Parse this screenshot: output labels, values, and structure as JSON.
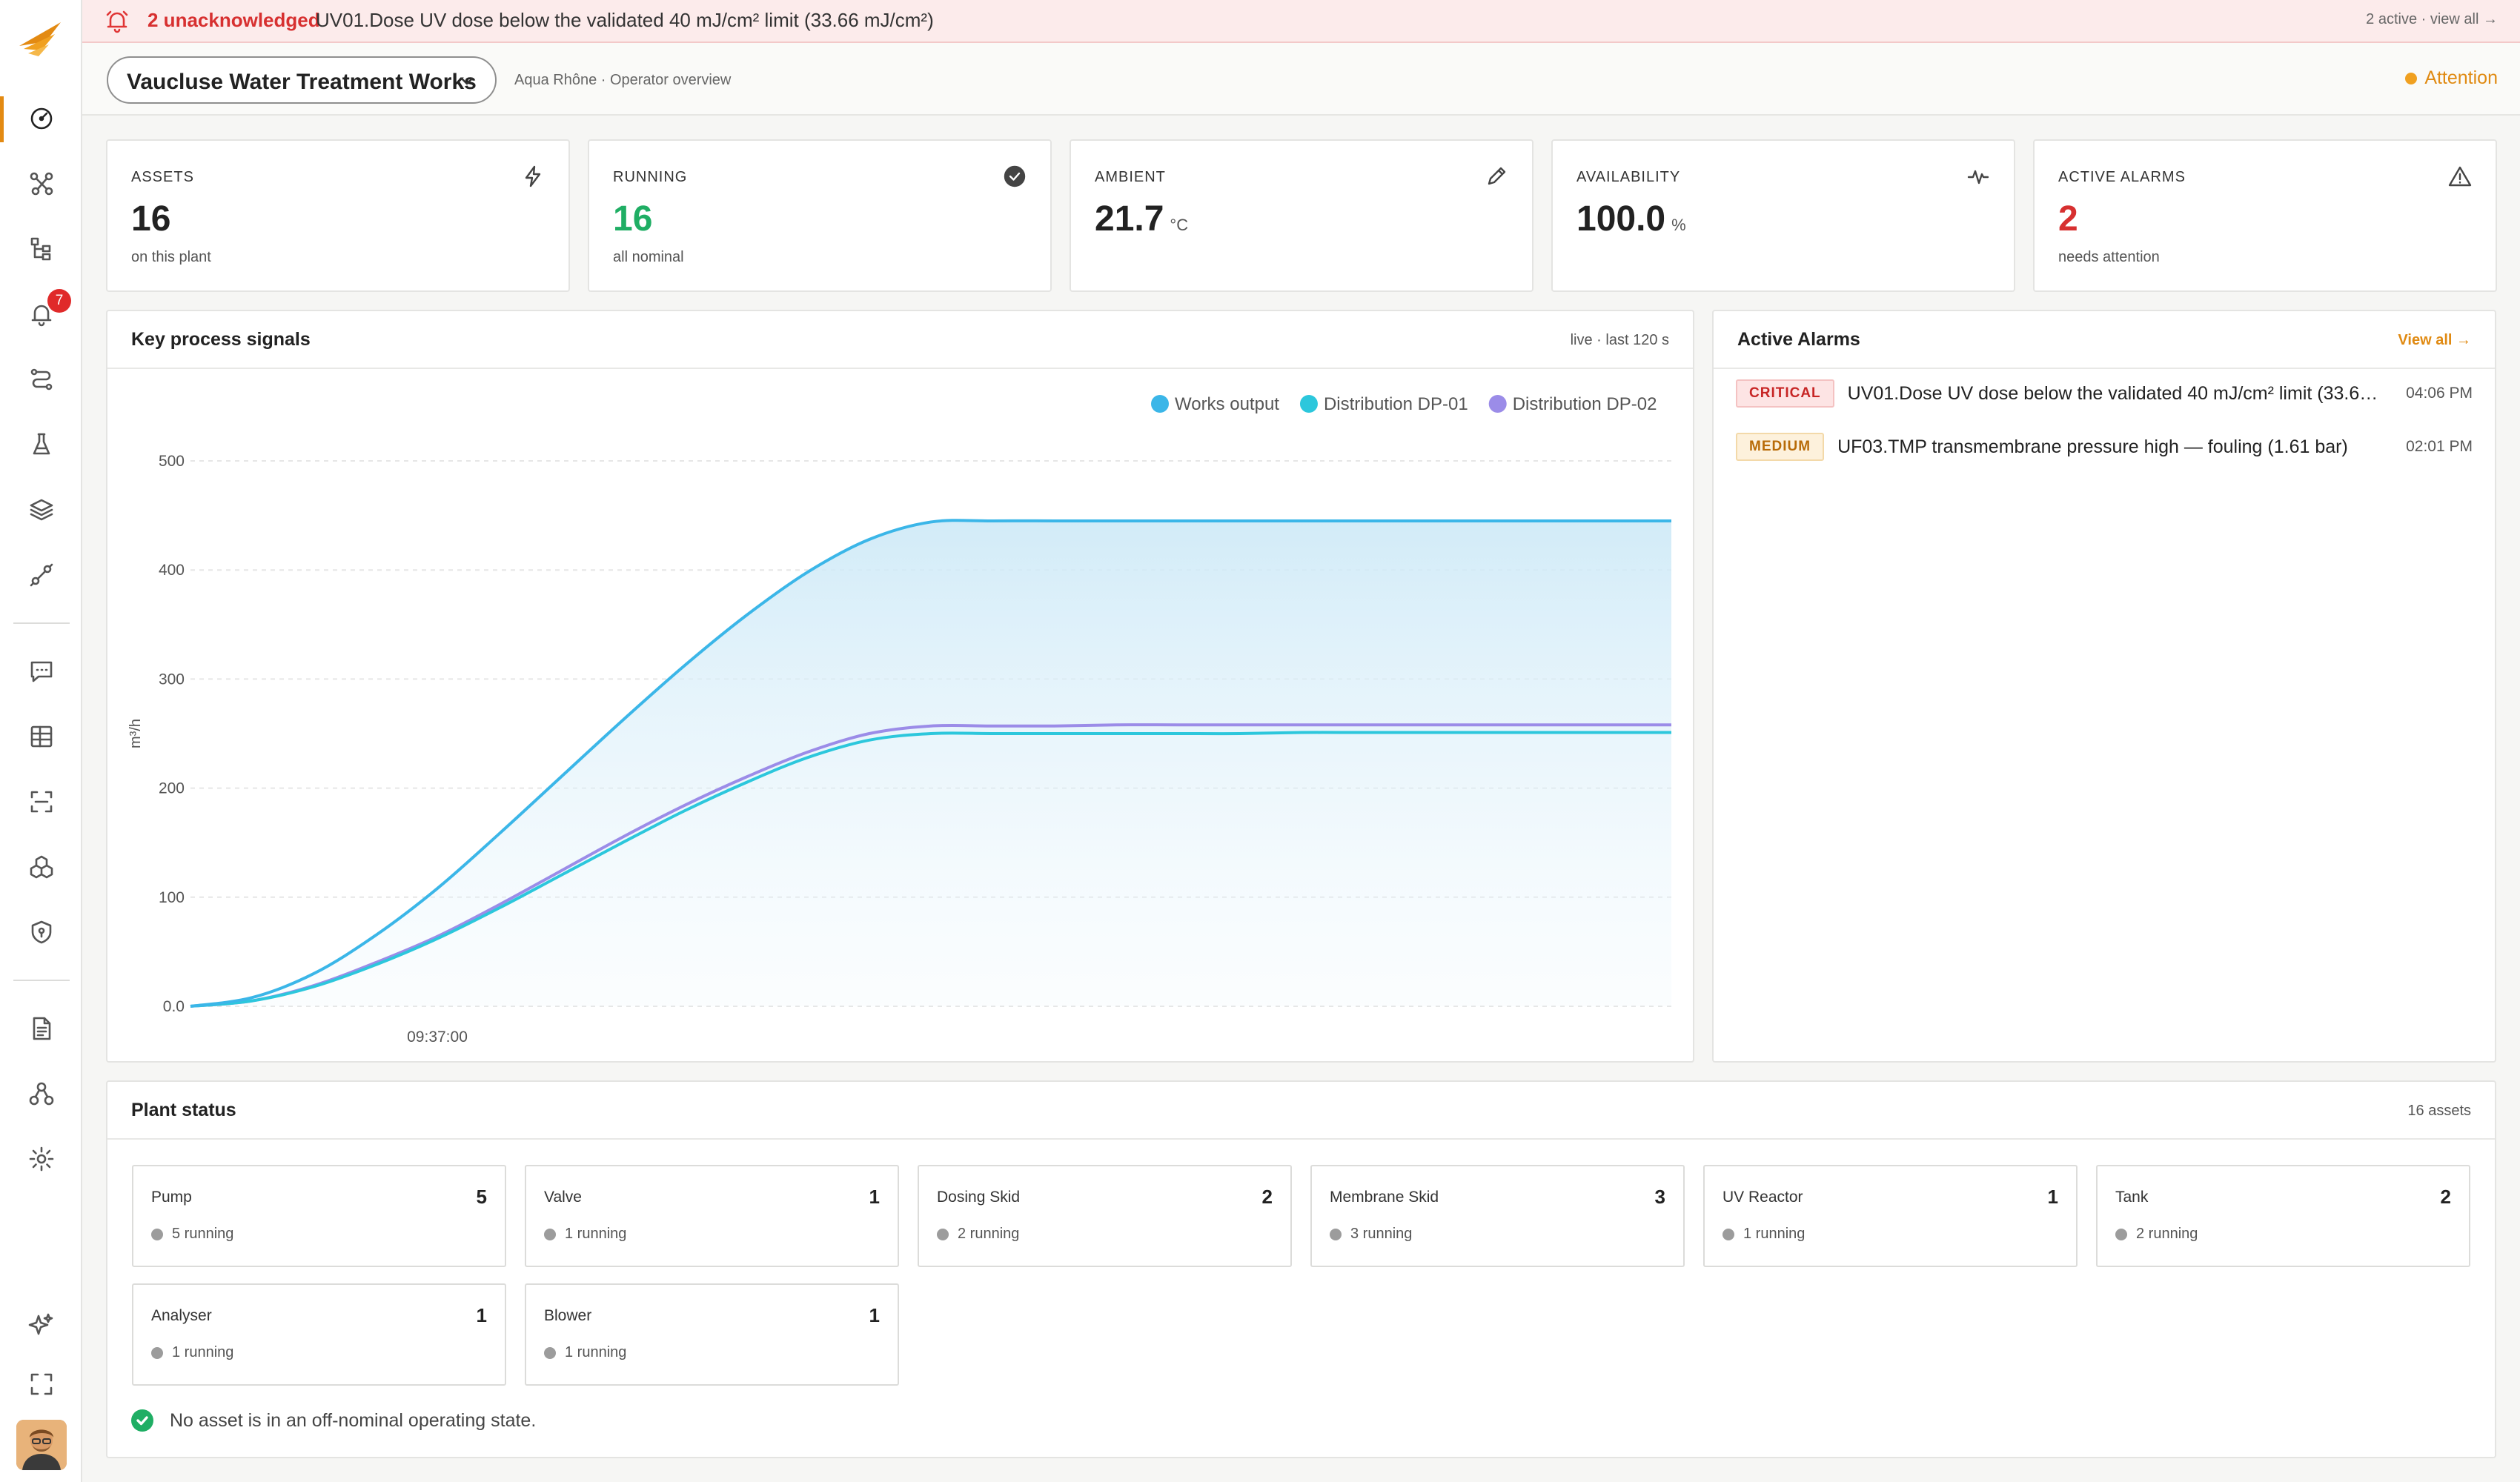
{
  "alert_banner": {
    "count_label": "2 unacknowledged",
    "message": "UV01.Dose UV dose below the validated 40 mJ/cm² limit (33.66 mJ/cm²)",
    "right_link": "2 active · view all →"
  },
  "sidebar": {
    "notification_badge": "7",
    "items": [
      "dashboard-icon",
      "connections-icon",
      "hierarchy-icon",
      "alarms-icon",
      "routes-icon",
      "lab-icon",
      "layers-icon",
      "integrations-icon",
      "messages-icon",
      "tables-icon",
      "scan-icon",
      "assets-icon",
      "security-icon",
      "reports-icon",
      "org-icon",
      "settings-icon",
      "sparkle-icon",
      "fullscreen-icon"
    ]
  },
  "header": {
    "plant_name": "Vaucluse Water Treatment Works",
    "subtitle": "Aqua Rhône · Operator overview",
    "status": "Attention",
    "status_color": "#f0a020"
  },
  "kpis": [
    {
      "label": "ASSETS",
      "value": "16",
      "unit": "",
      "sub": "on this plant",
      "icon": "bolt-icon"
    },
    {
      "label": "RUNNING",
      "value": "16",
      "unit": "",
      "sub": "all nominal",
      "icon": "check-circle-icon"
    },
    {
      "label": "AMBIENT",
      "value": "21.7",
      "unit": "°C",
      "sub": "",
      "icon": "pen-icon"
    },
    {
      "label": "AVAILABILITY",
      "value": "100.0",
      "unit": "%",
      "sub": "",
      "icon": "pulse-icon"
    },
    {
      "label": "ACTIVE ALARMS",
      "value": "2",
      "unit": "",
      "sub": "needs attention",
      "icon": "warning-icon"
    }
  ],
  "signals_panel": {
    "title": "Key process signals",
    "meta": "live · last 120 s"
  },
  "chart_data": {
    "type": "area",
    "title": "",
    "xlabel": "",
    "ylabel": "m³/h",
    "ylim": [
      0,
      500
    ],
    "y_ticks": [
      "0.0",
      "100",
      "200",
      "300",
      "400",
      "500"
    ],
    "x_tick_labels": [
      "09:37:00"
    ],
    "legend_position": "top-right",
    "grid": true,
    "x": [
      0,
      5,
      10,
      15,
      20,
      25,
      30,
      35,
      40,
      45,
      50,
      55,
      60,
      65,
      70,
      75,
      80,
      85,
      90,
      95,
      100,
      105,
      110,
      115,
      120
    ],
    "series": [
      {
        "name": "Works output",
        "color": "#3bb6e8",
        "values": [
          0,
          8,
          30,
          65,
          108,
          158,
          210,
          262,
          312,
          358,
          398,
          428,
          444,
          445,
          445,
          445,
          445,
          445,
          445,
          445,
          445,
          445,
          445,
          445,
          445
        ]
      },
      {
        "name": "Distribution DP-01",
        "color": "#2cc7dc",
        "values": [
          0,
          5,
          18,
          38,
          62,
          90,
          120,
          150,
          179,
          205,
          228,
          244,
          250,
          250,
          250,
          250,
          250,
          250,
          251,
          251,
          251,
          251,
          251,
          251,
          251
        ]
      },
      {
        "name": "Distribution DP-02",
        "color": "#9b8ce8",
        "values": [
          0,
          5,
          19,
          40,
          64,
          93,
          124,
          155,
          184,
          210,
          233,
          250,
          257,
          257,
          257,
          258,
          258,
          258,
          258,
          258,
          258,
          258,
          258,
          258,
          258
        ]
      }
    ]
  },
  "alarms_panel": {
    "title": "Active Alarms",
    "link": "View all →",
    "items": [
      {
        "severity": "CRITICAL",
        "text": "UV01.Dose UV dose below the validated 40 mJ/cm² limit (33.66 mJ/cm²)",
        "time": "04:06 PM"
      },
      {
        "severity": "MEDIUM",
        "text": "UF03.TMP transmembrane pressure high — fouling (1.61 bar)",
        "time": "02:01 PM"
      }
    ]
  },
  "plant_status": {
    "title": "Plant status",
    "meta": "16 assets",
    "assets": [
      {
        "name": "Pump",
        "count": "5",
        "running": "5 running"
      },
      {
        "name": "Valve",
        "count": "1",
        "running": "1 running"
      },
      {
        "name": "Dosing Skid",
        "count": "2",
        "running": "2 running"
      },
      {
        "name": "Membrane Skid",
        "count": "3",
        "running": "3 running"
      },
      {
        "name": "UV Reactor",
        "count": "1",
        "running": "1 running"
      },
      {
        "name": "Tank",
        "count": "2",
        "running": "2 running"
      },
      {
        "name": "Analyser",
        "count": "1",
        "running": "1 running"
      },
      {
        "name": "Blower",
        "count": "1",
        "running": "1 running"
      }
    ],
    "ok_message": "No asset is in an off-nominal operating state."
  }
}
